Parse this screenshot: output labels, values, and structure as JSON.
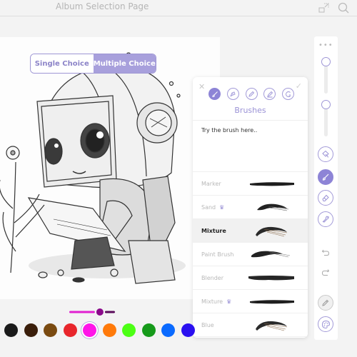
{
  "header": {
    "title": "Album Selection Page",
    "icons": [
      "expand-icon",
      "search-icon"
    ]
  },
  "mode_toggle": {
    "options": [
      "Single Choice",
      "Multiple Choice"
    ],
    "selected": "Multiple Choice"
  },
  "brush_panel": {
    "title": "Brushes",
    "tabs": [
      "brush-icon",
      "pen-tip-icon",
      "pencil-icon",
      "marker-icon",
      "eraser-shape-icon"
    ],
    "active_tab": "brush-icon",
    "try_area_placeholder": "Try the brush here..",
    "brushes": [
      {
        "name": "Marker",
        "premium": false,
        "selected": false,
        "stroke": "marker"
      },
      {
        "name": "Sand",
        "premium": true,
        "selected": false,
        "stroke": "sand"
      },
      {
        "name": "Mixture",
        "premium": false,
        "selected": true,
        "stroke": "mixture"
      },
      {
        "name": "Paint Brush",
        "premium": false,
        "selected": false,
        "stroke": "paint"
      },
      {
        "name": "Blender",
        "premium": false,
        "selected": false,
        "stroke": "blender"
      },
      {
        "name": "Mixture",
        "premium": true,
        "selected": false,
        "stroke": "marker"
      },
      {
        "name": "Blue",
        "premium": false,
        "selected": false,
        "stroke": "mixture"
      }
    ],
    "crown_glyph": "♛"
  },
  "toolbar": {
    "more_label": "•••",
    "sliders": [
      {
        "name": "opacity",
        "value": 1.0
      },
      {
        "name": "size",
        "value": 1.0
      }
    ],
    "tools": [
      "fill-bucket-icon",
      "brush-icon",
      "eraser-icon",
      "wrench-icon",
      "undo-icon",
      "redo-icon",
      "eyedropper-icon",
      "palette-icon"
    ],
    "active_tool": "brush-icon"
  },
  "color_picker": {
    "size_slider_value": 0.65,
    "swatches": [
      "#1a1a1a",
      "#3a1e0a",
      "#7a4a10",
      "#e8262c",
      "#ff14e8",
      "#ff7a0a",
      "#4cff14",
      "#169a1a",
      "#0a6aff",
      "#2a10f0"
    ],
    "selected_color": "#ff14e8",
    "slider_colors": {
      "track_left": "#e020d0",
      "knob": "#8a0a8a",
      "track_right": "#5a0a5a"
    }
  }
}
